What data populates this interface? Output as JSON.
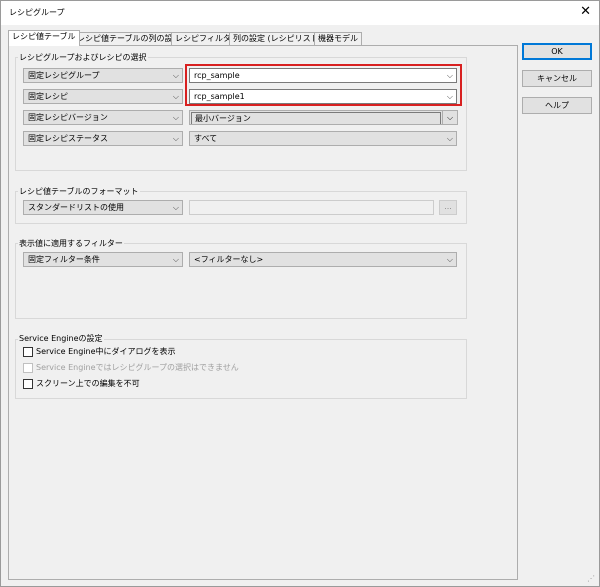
{
  "window": {
    "title": "レシピグループ",
    "close_glyph": "✕"
  },
  "tabs": [
    {
      "label": "レシピ値テーブル"
    },
    {
      "label": "レシピ値テーブルの列の設定"
    },
    {
      "label": "レシピフィルター"
    },
    {
      "label": "列の設定 (レシピリスト)"
    },
    {
      "label": "機器モデル"
    }
  ],
  "groups": {
    "selection": {
      "label": "レシピグループおよびレシピの選択",
      "rows": [
        {
          "mode": "固定レシピグループ",
          "value": "rcp_sample"
        },
        {
          "mode": "固定レシピ",
          "value": "rcp_sample1"
        },
        {
          "mode": "固定レシピバージョン",
          "value": "最小バージョン"
        },
        {
          "mode": "固定レシピステータス",
          "value": "すべて"
        }
      ]
    },
    "format": {
      "label": "レシピ値テーブルのフォーマット",
      "mode": "スタンダードリストの使用",
      "browse_label": "..."
    },
    "filter": {
      "label": "表示値に適用するフィルター",
      "mode": "固定フィルター条件",
      "value": "<フィルターなし>"
    },
    "engine": {
      "label": "Service Engineの設定",
      "checks": [
        {
          "label": "Service Engine中にダイアログを表示",
          "checked": false,
          "disabled": false
        },
        {
          "label": "Service Engineではレシピグループの選択はできません",
          "checked": false,
          "disabled": true
        },
        {
          "label": "スクリーン上での編集を不可",
          "checked": false,
          "disabled": false
        }
      ]
    }
  },
  "buttons": {
    "ok": "OK",
    "cancel": "キャンセル",
    "help": "ヘルプ"
  },
  "icons": {
    "chevron": "⌵",
    "grip": "⋰"
  },
  "colors": {
    "highlight": "#d82020",
    "default_button_border": "#0078d7"
  }
}
